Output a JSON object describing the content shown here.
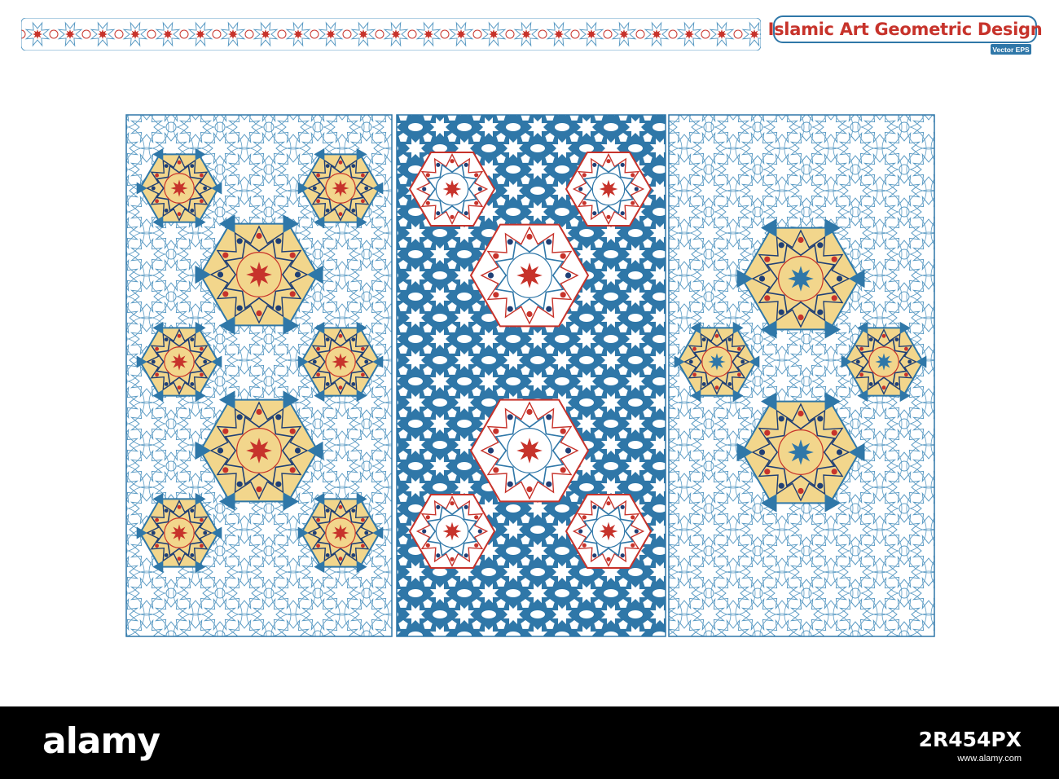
{
  "header": {
    "title": "Islamic Art Geometric Design",
    "subtitle": "Vector EPS"
  },
  "panels": [
    {
      "name": "left-panel",
      "style": "outline",
      "medallion_layout": "small-large-pairs"
    },
    {
      "name": "center-panel",
      "style": "solid-blue",
      "medallion_layout": "two-column"
    },
    {
      "name": "right-panel",
      "style": "outline",
      "medallion_layout": "diamond"
    }
  ],
  "watermark": {
    "logo": "alamy",
    "image_id": "2R454PX",
    "meta": "www.alamy.com"
  },
  "colors": {
    "blue": "#2f77a8",
    "line_blue": "#5b9bc4",
    "red": "#c7332b",
    "yellow": "#f2d68c",
    "navy": "#1f3f75"
  }
}
